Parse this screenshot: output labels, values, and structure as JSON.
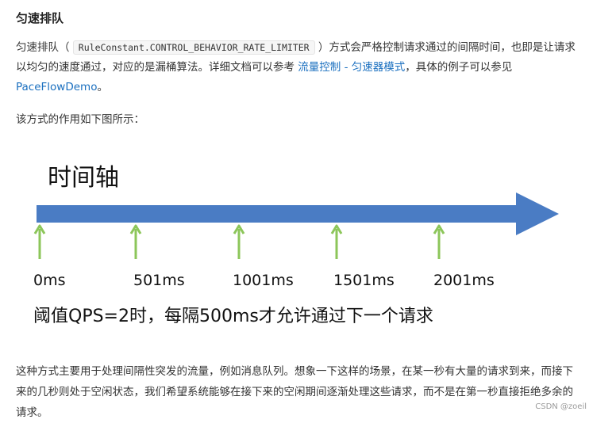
{
  "section": {
    "title": "匀速排队"
  },
  "intro": {
    "part1": "匀速排队（ ",
    "code": "RuleConstant.CONTROL_BEHAVIOR_RATE_LIMITER",
    "part2": " ）方式会严格控制请求通过的间隔时间，也即是让请求以均匀的速度通过，对应的是漏桶算法。详细文档可以参考 ",
    "link1": "流量控制 - 匀速器模式",
    "part3": "，具体的例子可以参见 ",
    "link2": "PaceFlowDemo",
    "part4": "。"
  },
  "diagram_intro": "该方式的作用如下图所示：",
  "diagram": {
    "title": "时间轴",
    "ticks": [
      "0ms",
      "501ms",
      "1001ms",
      "1501ms",
      "2001ms"
    ],
    "caption": "阈值QPS=2时，每隔500ms才允许通过下一个请求",
    "colors": {
      "axis": "#4a7cc4",
      "tick_arrow": "#8cc65a"
    }
  },
  "usage": "这种方式主要用于处理间隔性突发的流量，例如消息队列。想象一下这样的场景，在某一秒有大量的请求到来，而接下来的几秒则处于空闲状态，我们希望系统能够在接下来的空闲期间逐渐处理这些请求，而不是在第一秒直接拒绝多余的请求。",
  "watermark": "CSDN @zoeil"
}
